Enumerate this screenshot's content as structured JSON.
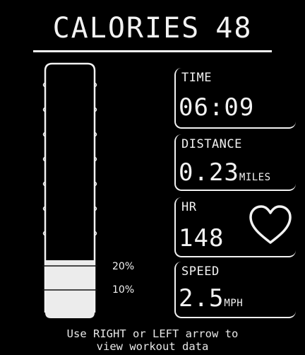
{
  "header": {
    "label": "CALORIES",
    "value": "48"
  },
  "progress": {
    "fill_fraction": 0.2,
    "marks": [
      {
        "label": "20%",
        "value": 0.2
      },
      {
        "label": "10%",
        "value": 0.1
      }
    ]
  },
  "stats": {
    "time": {
      "label": "TIME",
      "value": "06:09"
    },
    "distance": {
      "label": "DISTANCE",
      "value": "0.23",
      "unit": "MILES"
    },
    "hr": {
      "label": "HR",
      "value": "148",
      "icon": "heart-icon"
    },
    "speed": {
      "label": "SPEED",
      "value": "2.5",
      "unit": "MPH"
    }
  },
  "footer": {
    "line1": "Use RIGHT or LEFT arrow to",
    "line2": "view workout data"
  },
  "colors": {
    "background": "#000000",
    "foreground": "#f2f2f2"
  }
}
